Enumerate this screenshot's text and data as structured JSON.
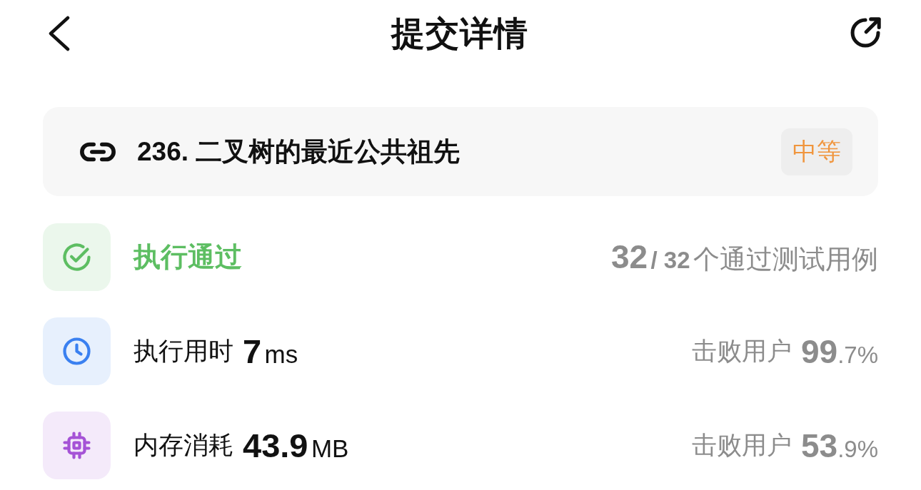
{
  "header": {
    "title": "提交详情"
  },
  "problem": {
    "title": "236. 二叉树的最近公共祖先",
    "difficulty": "中等"
  },
  "stats": [
    {
      "kind": "status",
      "color": "#5dbe62",
      "label": "执行通过",
      "passed": "32",
      "separator": "/",
      "total": "32",
      "note": "个通过测试用例"
    },
    {
      "kind": "runtime",
      "color": "#3a80f0",
      "label": "执行用时",
      "value": "7",
      "unit": "ms",
      "beats_label": "击败用户",
      "beats_whole": "99",
      "beats_fraction": ".7%"
    },
    {
      "kind": "memory",
      "color": "#a553d6",
      "label": "内存消耗",
      "value": "43.9",
      "unit": "MB",
      "beats_label": "击败用户",
      "beats_whole": "53",
      "beats_fraction": ".9%"
    }
  ]
}
